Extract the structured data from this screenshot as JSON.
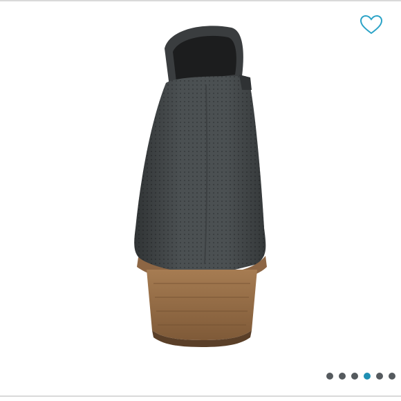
{
  "viewer": {
    "favorite_icon": "heart-outline-icon",
    "favorite_color": "#2ba3c7",
    "pagination": {
      "total": 6,
      "current": 4,
      "active_color": "#1f8fb3",
      "inactive_color": "#555a5e"
    }
  }
}
